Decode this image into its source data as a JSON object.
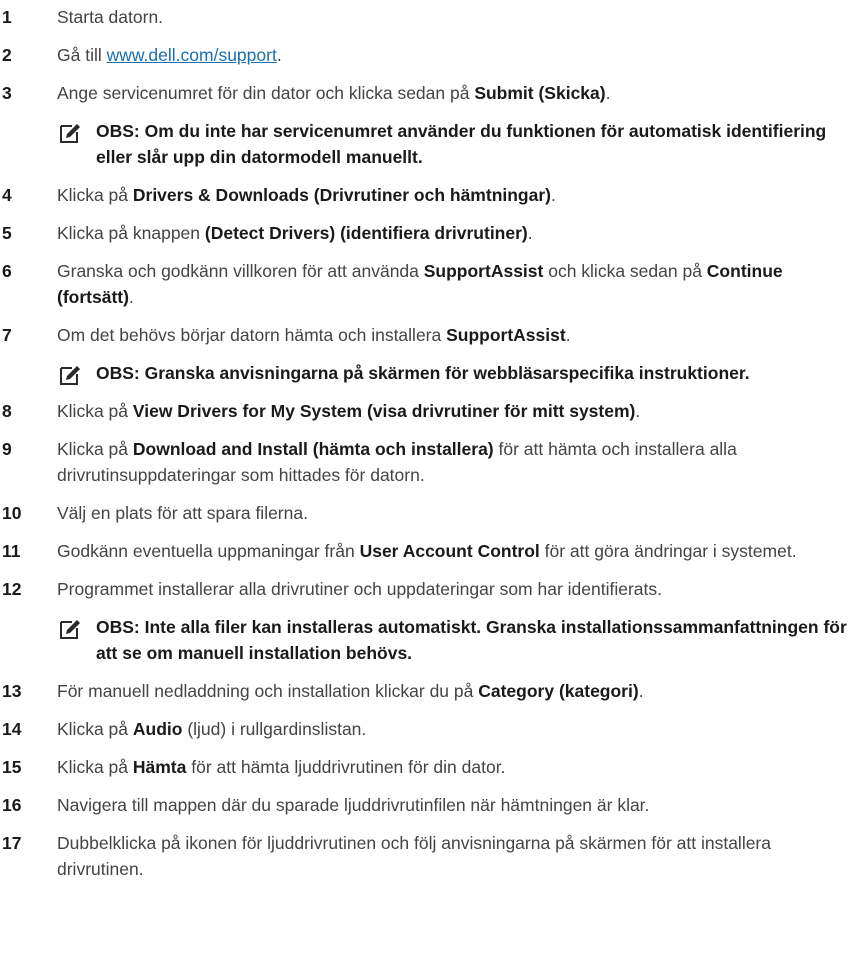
{
  "steps": [
    {
      "n": "1",
      "parts": [
        {
          "t": "Starta datorn."
        }
      ]
    },
    {
      "n": "2",
      "parts": [
        {
          "t": "Gå till "
        },
        {
          "t": "www.dell.com/support",
          "link": true
        },
        {
          "t": "."
        }
      ]
    },
    {
      "n": "3",
      "parts": [
        {
          "t": "Ange servicenumret för din dator och klicka sedan på "
        },
        {
          "t": "Submit (Skicka)",
          "b": true
        },
        {
          "t": "."
        }
      ],
      "note": "OBS: Om du inte har servicenumret använder du funktionen för automatisk identifiering eller slår upp din datormodell manuellt."
    },
    {
      "n": "4",
      "parts": [
        {
          "t": "Klicka på "
        },
        {
          "t": "Drivers & Downloads (Drivrutiner och hämtningar)",
          "b": true
        },
        {
          "t": "."
        }
      ]
    },
    {
      "n": "5",
      "parts": [
        {
          "t": "Klicka på knappen "
        },
        {
          "t": "(Detect Drivers) (identifiera drivrutiner)",
          "b": true
        },
        {
          "t": "."
        }
      ]
    },
    {
      "n": "6",
      "parts": [
        {
          "t": "Granska och godkänn villkoren för att använda "
        },
        {
          "t": "SupportAssist",
          "b": true
        },
        {
          "t": " och klicka sedan på "
        },
        {
          "t": "Continue (fortsätt)",
          "b": true
        },
        {
          "t": "."
        }
      ]
    },
    {
      "n": "7",
      "parts": [
        {
          "t": "Om det behövs börjar datorn hämta och installera "
        },
        {
          "t": "SupportAssist",
          "b": true
        },
        {
          "t": "."
        }
      ],
      "note": "OBS: Granska anvisningarna på skärmen för webbläsarspecifika instruktioner."
    },
    {
      "n": "8",
      "parts": [
        {
          "t": "Klicka på "
        },
        {
          "t": "View Drivers for My System (visa drivrutiner för mitt system)",
          "b": true
        },
        {
          "t": "."
        }
      ]
    },
    {
      "n": "9",
      "parts": [
        {
          "t": "Klicka på "
        },
        {
          "t": "Download and Install (hämta och installera)",
          "b": true
        },
        {
          "t": " för att hämta och installera alla drivrutinsuppdateringar som hittades för datorn."
        }
      ]
    },
    {
      "n": "10",
      "parts": [
        {
          "t": "Välj en plats för att spara filerna."
        }
      ]
    },
    {
      "n": "11",
      "parts": [
        {
          "t": "Godkänn eventuella uppmaningar från "
        },
        {
          "t": "User Account Control",
          "b": true
        },
        {
          "t": " för att göra ändringar i systemet."
        }
      ]
    },
    {
      "n": "12",
      "parts": [
        {
          "t": "Programmet installerar alla drivrutiner och uppdateringar som har identifierats."
        }
      ],
      "note": "OBS: Inte alla filer kan installeras automatiskt. Granska installationssammanfattningen för att se om manuell installation behövs."
    },
    {
      "n": "13",
      "parts": [
        {
          "t": "För manuell nedladdning och installation klickar du på "
        },
        {
          "t": "Category (kategori)",
          "b": true
        },
        {
          "t": "."
        }
      ]
    },
    {
      "n": "14",
      "parts": [
        {
          "t": "Klicka på "
        },
        {
          "t": "Audio",
          "b": true
        },
        {
          "t": " (ljud) i rullgardinslistan."
        }
      ]
    },
    {
      "n": "15",
      "parts": [
        {
          "t": "Klicka på "
        },
        {
          "t": "Hämta",
          "b": true
        },
        {
          "t": " för att hämta ljuddrivrutinen för din dator."
        }
      ]
    },
    {
      "n": "16",
      "parts": [
        {
          "t": "Navigera till mappen där du sparade ljuddrivrutinfilen när hämtningen är klar."
        }
      ]
    },
    {
      "n": "17",
      "parts": [
        {
          "t": "Dubbelklicka på ikonen för ljuddrivrutinen och följ anvisningarna på skärmen för att installera drivrutinen."
        }
      ]
    }
  ],
  "icons": {
    "note": "note-pencil-icon"
  },
  "colors": {
    "text": "#444444",
    "bold": "#1a1a1a",
    "link": "#1a6fb3"
  }
}
